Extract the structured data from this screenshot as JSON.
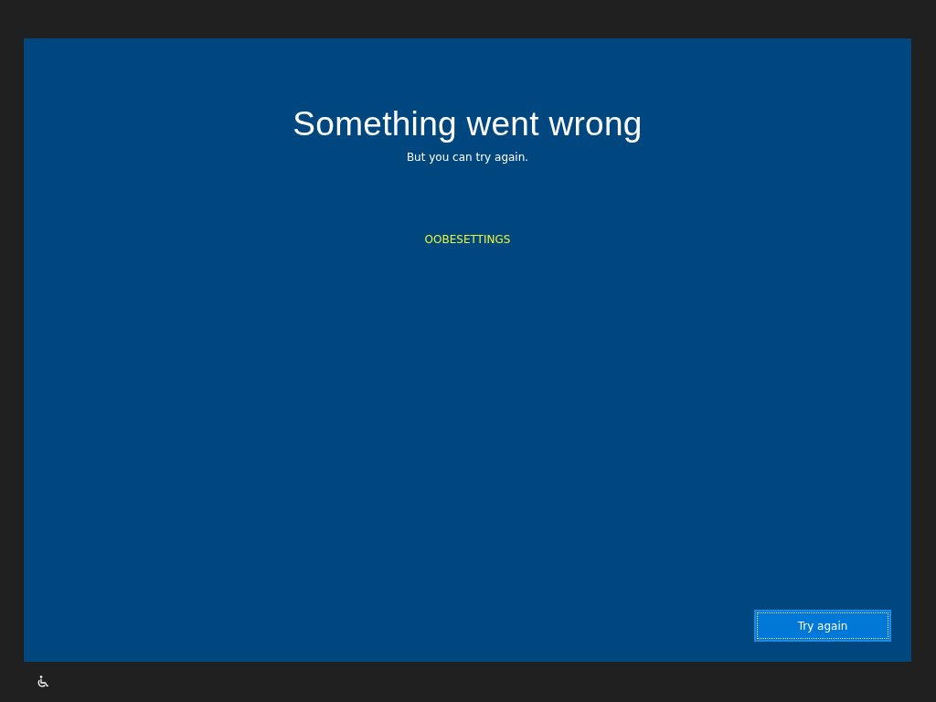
{
  "title": "Something went wrong",
  "subtitle": "But you can try again.",
  "error_code": "OOBESETTINGS",
  "button": {
    "label": "Try again",
    "focused": true
  }
}
